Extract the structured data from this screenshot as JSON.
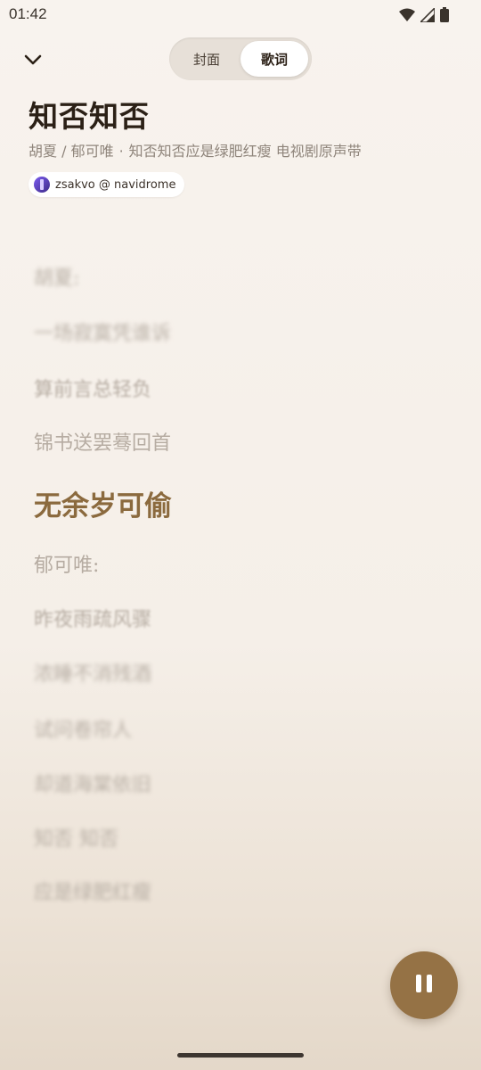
{
  "status_bar": {
    "time": "01:42",
    "icons": [
      "wifi-icon",
      "signal-icon",
      "battery-icon"
    ]
  },
  "header": {
    "collapse_icon": "chevron-down-icon",
    "tabs": [
      {
        "label": "封面",
        "selected": false
      },
      {
        "label": "歌词",
        "selected": true
      }
    ]
  },
  "song": {
    "title": "知否知否",
    "artists": "胡夏 / 郁可唯",
    "separator": "·",
    "album": "知否知否应是绿肥红瘦 电视剧原声带",
    "source": "zsakvo @ navidrome"
  },
  "lyrics": {
    "lines": [
      "胡夏:",
      "一场寂寞凭谁诉",
      "算前言总轻负",
      "锦书送罢蓦回首",
      "无余岁可偷",
      "郁可唯:",
      "昨夜雨疏风骤",
      "浓睡不消残酒",
      "试问卷帘人",
      "却道海棠依旧",
      "知否 知否",
      "应是绿肥红瘦"
    ],
    "current_index": 4
  },
  "player": {
    "play_state_icon": "pause-icon"
  },
  "colors": {
    "accent": "#957245",
    "current_lyric": "#8b6a3e",
    "background": "#f8f3ee"
  }
}
